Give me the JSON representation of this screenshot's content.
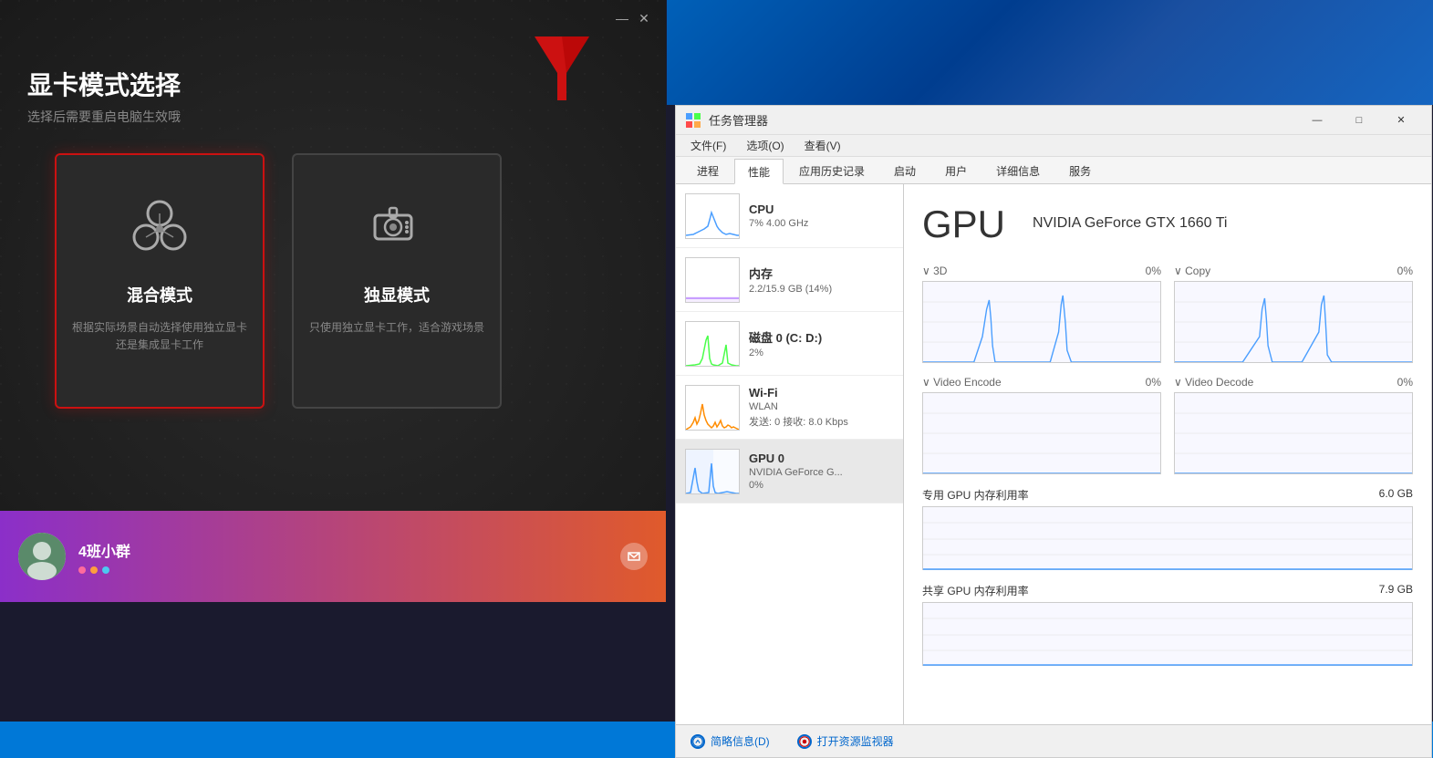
{
  "gpu_window": {
    "title": "显卡模式选择",
    "subtitle": "选择后需要重启电脑生效哦",
    "minimize_btn": "—",
    "close_btn": "✕",
    "modes": [
      {
        "id": "mixed",
        "name": "混合模式",
        "desc": "根据实际场景自动选择使用独立显卡还是集成显卡工作",
        "selected": true
      },
      {
        "id": "discrete",
        "name": "独显模式",
        "desc": "只使用独立显卡工作，适合游戏场景",
        "selected": false
      }
    ]
  },
  "chat_bar": {
    "group_name": "4班小群",
    "dots": [
      "#ff6b9d",
      "#ff9e3d",
      "#4dc8f0"
    ]
  },
  "task_manager": {
    "title": "任务管理器",
    "window_buttons": [
      "—",
      "□",
      "✕"
    ],
    "menu_items": [
      "文件(F)",
      "选项(O)",
      "查看(V)"
    ],
    "tabs": [
      "进程",
      "性能",
      "应用历史记录",
      "启动",
      "用户",
      "详细信息",
      "服务"
    ],
    "active_tab": "性能",
    "sidebar_items": [
      {
        "name": "CPU",
        "detail": "7% 4.00 GHz",
        "graph_color": "#4a9eff"
      },
      {
        "name": "内存",
        "detail": "2.2/15.9 GB (14%)",
        "graph_color": "#9b4fff"
      },
      {
        "name": "磁盘 0 (C: D:)",
        "detail": "2%",
        "graph_color": "#4aff4a"
      },
      {
        "name": "Wi-Fi",
        "detail": "WLAN\n发送: 0  接收: 8.0 Kbps",
        "detail_line1": "WLAN",
        "detail_line2": "发送: 0  接收: 8.0 Kbps",
        "graph_color": "#ff8c00"
      },
      {
        "name": "GPU 0",
        "detail_line1": "NVIDIA GeForce G...",
        "detail_line2": "0%",
        "graph_color": "#4a9eff",
        "selected": true
      }
    ],
    "gpu_section": {
      "title": "GPU",
      "model": "NVIDIA GeForce GTX 1660 Ti",
      "charts": [
        {
          "label": "3D",
          "value": "0%"
        },
        {
          "label": "Copy",
          "value": "0%"
        },
        {
          "label": "Video Encode",
          "value": "0%"
        },
        {
          "label": "Video Decode",
          "value": "0%"
        }
      ],
      "memory_sections": [
        {
          "label": "专用 GPU 内存利用率",
          "value": "6.0 GB"
        },
        {
          "label": "共享 GPU 内存利用率",
          "value": "7.9 GB"
        }
      ]
    },
    "footer": {
      "btn1": "简略信息(D)",
      "btn2": "打开资源监视器"
    }
  }
}
